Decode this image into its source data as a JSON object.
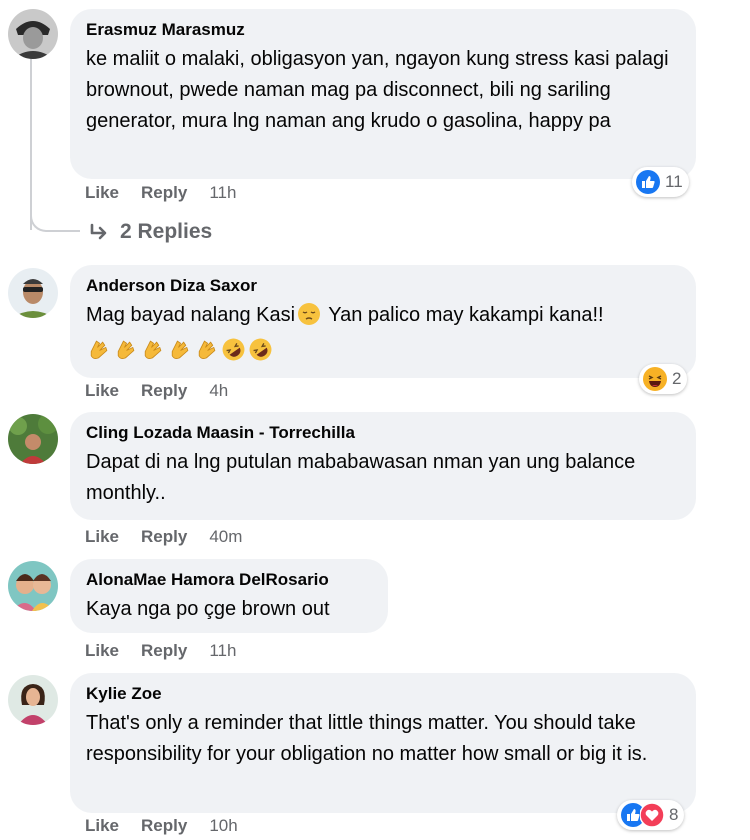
{
  "comments": [
    {
      "author": "Erasmuz Marasmuz",
      "text": "ke maliit o malaki, obligasyon yan, ngayon kung stress kasi palagi brownout, pwede naman mag pa disconnect, bili ng sariling generator, mura lng naman ang krudo o gasolina, happy pa",
      "like_label": "Like",
      "reply_label": "Reply",
      "time": "11h",
      "reaction_count": "11",
      "reaction_icons": [
        "like-reaction-icon"
      ],
      "replies_label": "2 Replies"
    },
    {
      "author": "Anderson Diza Saxor",
      "text_before_emoji": "Mag bayad nalang Kasi",
      "text_after_emoji": " Yan palico may kakampi kana!!",
      "emoji_line": [
        "clap-emoji",
        "clap-emoji",
        "clap-emoji",
        "clap-emoji",
        "clap-emoji",
        "rofl-emoji",
        "rofl-emoji"
      ],
      "like_label": "Like",
      "reply_label": "Reply",
      "time": "4h",
      "reaction_count": "2",
      "reaction_icons": [
        "haha-reaction-icon"
      ]
    },
    {
      "author": "Cling Lozada Maasin - Torrechilla",
      "text": "Dapat di na lng putulan mababawasan nman yan ung balance monthly..",
      "like_label": "Like",
      "reply_label": "Reply",
      "time": "40m"
    },
    {
      "author": "AlonaMae Hamora DelRosario",
      "text": "Kaya nga po çge brown out",
      "like_label": "Like",
      "reply_label": "Reply",
      "time": "11h"
    },
    {
      "author": "Kylie Zoe",
      "text": "That's only a reminder that little things matter. You should take responsibility for your obligation no matter how small or big it is.",
      "like_label": "Like",
      "reply_label": "Reply",
      "time": "10h",
      "reaction_count": "8",
      "reaction_icons": [
        "like-reaction-icon",
        "love-reaction-icon"
      ]
    }
  ],
  "colors": {
    "bubble": "#f0f2f5",
    "meta_text": "#65676b",
    "like_blue": "#1877f2",
    "love_red": "#f33e58",
    "haha_yellow": "#f7b125"
  }
}
